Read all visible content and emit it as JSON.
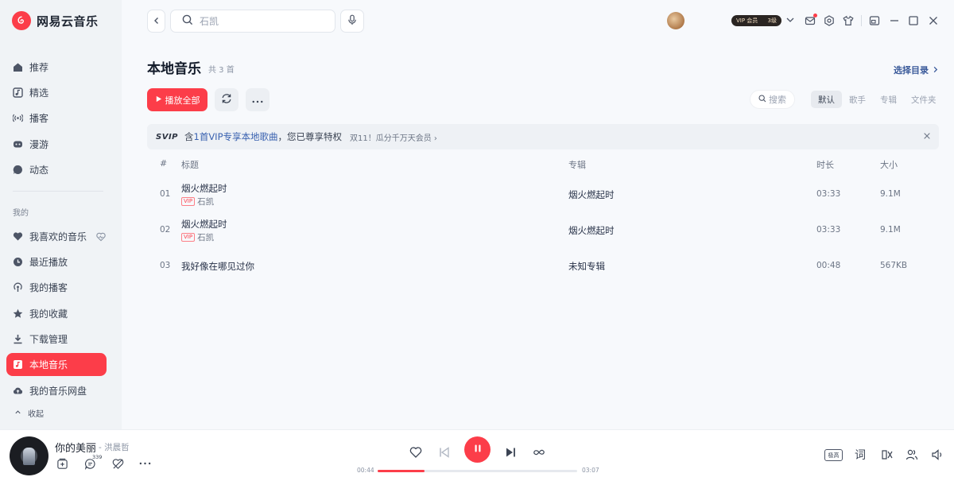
{
  "app": {
    "name": "网易云音乐",
    "brand_color": "#fc3d49"
  },
  "sidebar": {
    "main_items": [
      {
        "label": "推荐",
        "icon": "home-icon"
      },
      {
        "label": "精选",
        "icon": "music-note-icon"
      },
      {
        "label": "播客",
        "icon": "radio-waves-icon"
      },
      {
        "label": "漫游",
        "icon": "roam-icon"
      },
      {
        "label": "动态",
        "icon": "chat-bubble-icon"
      }
    ],
    "section_label": "我的",
    "my_items": [
      {
        "label": "我喜欢的音乐",
        "icon": "heart-icon"
      },
      {
        "label": "最近播放",
        "icon": "clock-icon"
      },
      {
        "label": "我的播客",
        "icon": "podcast-icon"
      },
      {
        "label": "我的收藏",
        "icon": "star-icon"
      },
      {
        "label": "下载管理",
        "icon": "download-icon"
      },
      {
        "label": "本地音乐",
        "icon": "local-music-icon",
        "active": true
      },
      {
        "label": "我的音乐网盘",
        "icon": "cloud-upload-icon"
      }
    ],
    "collapse_label": "收起"
  },
  "topbar": {
    "search_placeholder": "石凯",
    "vip_badge_left": "VIP 会员",
    "vip_badge_right": "3级"
  },
  "page": {
    "title": "本地音乐",
    "count": "共 3 首",
    "choose_dir": "选择目录",
    "play_all": "播放全部",
    "mini_search": "搜索",
    "sort_tabs": [
      "默认",
      "歌手",
      "专辑",
      "文件夹"
    ],
    "sort_active": "默认"
  },
  "banner": {
    "svip": "SVIP",
    "text_pre": "含",
    "text_hl": "1首VIP专享本地歌曲",
    "text_post": "，您已尊享特权",
    "promo": "双11！瓜分千万天会员 ›"
  },
  "table": {
    "headers": {
      "num": "#",
      "title": "标题",
      "album": "专辑",
      "duration": "时长",
      "size": "大小"
    },
    "rows": [
      {
        "num": "01",
        "title": "烟火燃起时",
        "vip": "VIP",
        "artist": "石凯",
        "album": "烟火燃起时",
        "duration": "03:33",
        "size": "9.1M"
      },
      {
        "num": "02",
        "title": "烟火燃起时",
        "vip": "VIP",
        "artist": "石凯",
        "album": "烟火燃起时",
        "duration": "03:33",
        "size": "9.1M"
      },
      {
        "num": "03",
        "title": "我好像在哪见过你",
        "vip": "",
        "artist": "",
        "album": "未知专辑",
        "duration": "00:48",
        "size": "567KB"
      }
    ]
  },
  "player": {
    "song": "你的美丽",
    "artist": "- 洪晨哲",
    "comment_count": "339",
    "time_current": "00:44",
    "time_total": "03:07",
    "progress": 0.235,
    "quality": "极高",
    "lyric_label": "词"
  }
}
